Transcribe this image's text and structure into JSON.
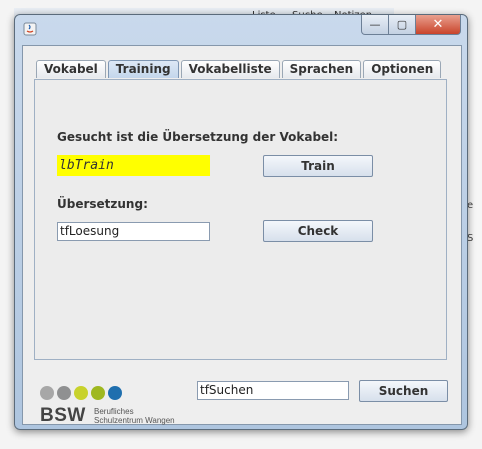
{
  "background": {
    "bar_items": [
      "Liste",
      "Suche",
      "Notizen"
    ],
    "right_letters": [
      "e",
      "S"
    ]
  },
  "window": {
    "controls": {
      "minimize": "—",
      "maximize": "▢",
      "close": "✕"
    }
  },
  "tabs": [
    {
      "label": "Vokabel",
      "active": false
    },
    {
      "label": "Training",
      "active": true
    },
    {
      "label": "Vokabelliste",
      "active": false
    },
    {
      "label": "Sprachen",
      "active": false
    },
    {
      "label": "Optionen",
      "active": false
    }
  ],
  "training": {
    "prompt_label": "Gesucht ist die Übersetzung der Vokabel:",
    "vocab_display": "lbTrain",
    "train_button": "Train",
    "translation_label": "Übersetzung:",
    "translation_input": "tfLoesung",
    "check_button": "Check"
  },
  "footer": {
    "logo_text": "BSW",
    "logo_sub_1": "Berufliches",
    "logo_sub_2": "Schulzentrum Wangen",
    "logo_colors": [
      "#a7a7a7",
      "#8f9091",
      "#c8d22c",
      "#9fb820",
      "#1f6fae"
    ],
    "search_input": "tfSuchen",
    "search_button": "Suchen"
  }
}
